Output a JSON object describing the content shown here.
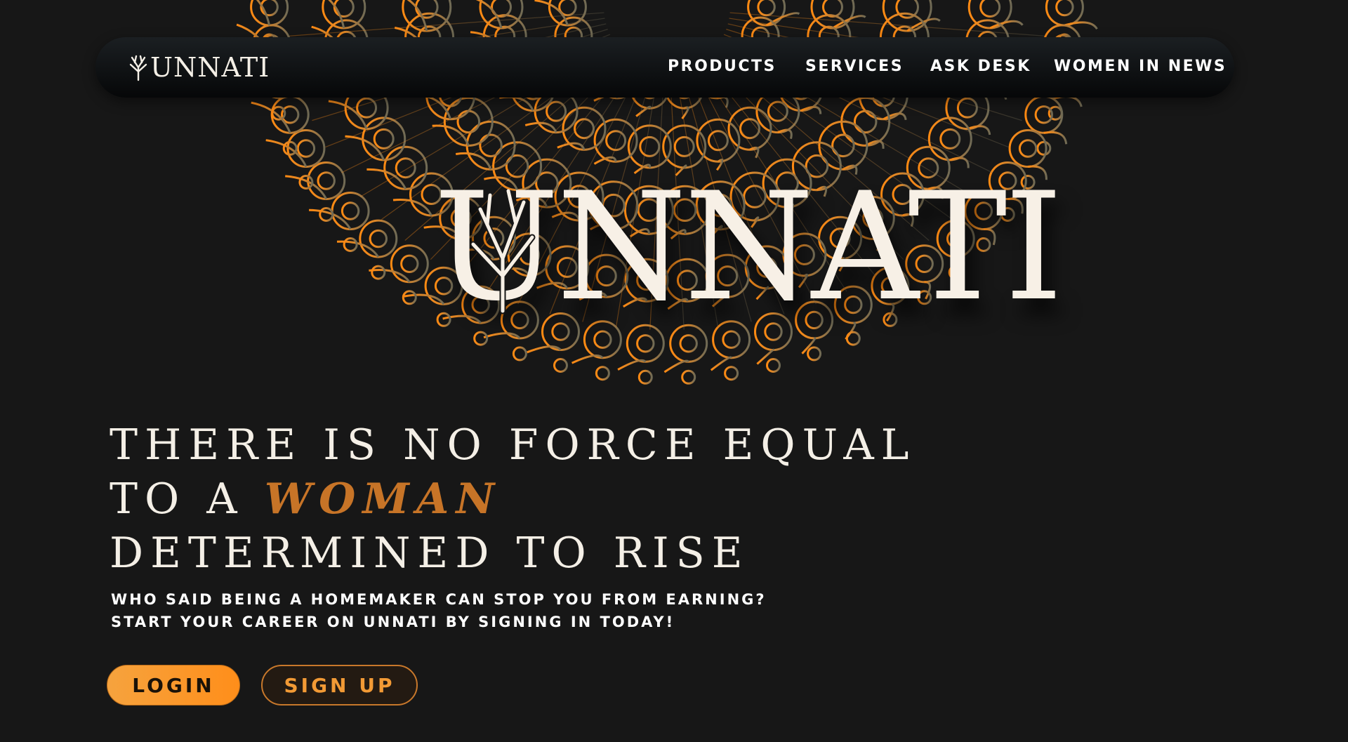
{
  "brand": {
    "name": "UNNATI"
  },
  "nav": {
    "items": [
      {
        "label": "PRODUCTS"
      },
      {
        "label": "SERVICES"
      },
      {
        "label": "ASK DESK"
      },
      {
        "label": "WOMEN IN NEWS"
      }
    ]
  },
  "hero": {
    "logo_text": "UNNATI",
    "headline_line1": "THERE IS NO FORCE EQUAL",
    "headline_line2_prefix": "TO A",
    "headline_line2_accent": "WOMAN",
    "headline_line3": "DETERMINED TO RISE",
    "sub_line1": "WHO SAID BEING A HOMEMAKER CAN STOP YOU FROM EARNING?",
    "sub_line2": "START YOUR CAREER ON UNNATI BY SIGNING IN TODAY!",
    "login_label": "LOGIN",
    "signup_label": "SIGN UP"
  },
  "colors": {
    "background": "#171717",
    "accent_orange": "#ff8e1a",
    "accent_text": "#c77427",
    "cream": "#f4efe6"
  },
  "icons": {
    "decoration": "mandala-ornament",
    "logo_mark": "tree-branch-icon"
  }
}
